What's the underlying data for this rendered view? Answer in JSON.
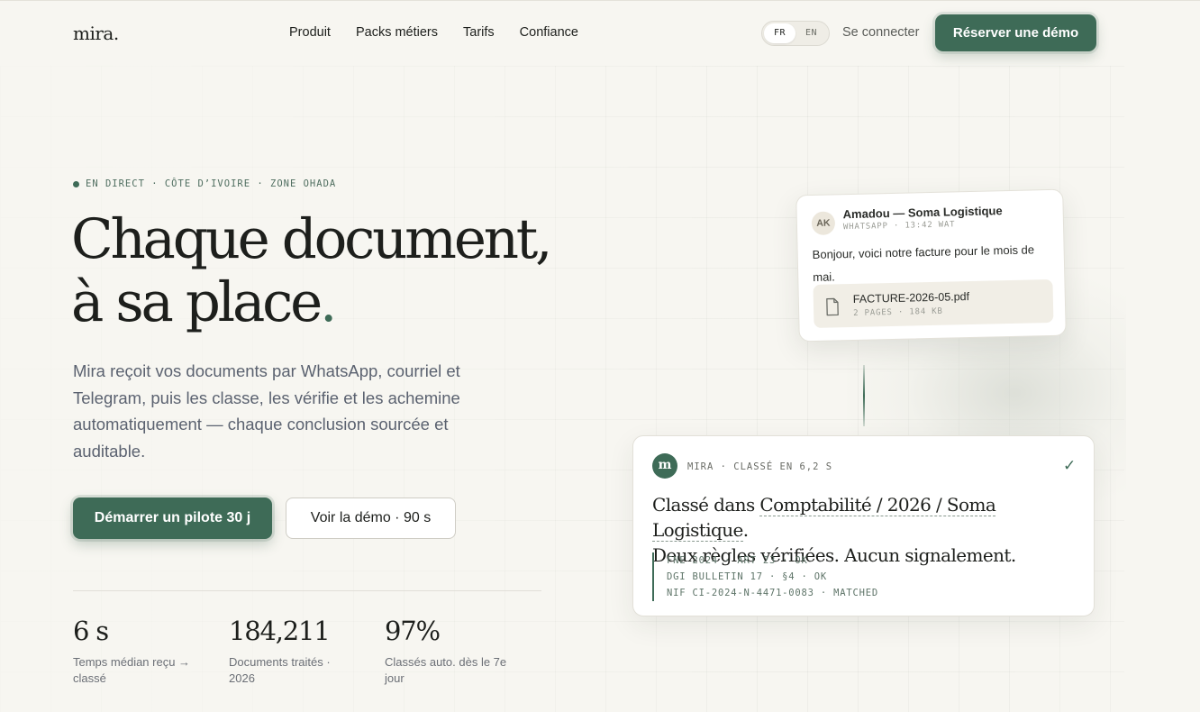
{
  "brand": {
    "logo": "mira."
  },
  "nav": {
    "items": [
      {
        "label": "Produit"
      },
      {
        "label": "Packs métiers"
      },
      {
        "label": "Tarifs"
      },
      {
        "label": "Confiance"
      }
    ],
    "lang": {
      "options": [
        "FR",
        "EN"
      ],
      "selected": "FR"
    },
    "login": "Se connecter",
    "cta": "Réserver une démo"
  },
  "hero": {
    "eyebrow": "EN DIRECT · CÔTE D’IVOIRE · ZONE OHADA",
    "headline_line1": "Chaque document,",
    "headline_line2": "à sa place",
    "headline_dot": ".",
    "lede": "Mira reçoit vos documents par WhatsApp, courriel et Telegram, puis les classe, les vérifie et les achemine automatiquement — chaque conclusion sourcée et auditable.",
    "primary_cta": "Démarrer un pilote 30 j",
    "secondary_cta": "Voir la démo · 90 s"
  },
  "stats": [
    {
      "value": "6 s",
      "label": "Temps médian reçu → classé"
    },
    {
      "value": "184,211",
      "label": "Documents traités · 2026"
    },
    {
      "value": "97%",
      "label": "Classés auto. dès le 7e jour"
    }
  ],
  "message_card": {
    "avatar": "AK",
    "sender": "Amadou — Soma Logistique",
    "meta": "WHATSAPP · 13:42 WAT",
    "text": "Bonjour, voici notre facture pour le mois de mai.",
    "file": {
      "name": "FACTURE-2026-05.pdf",
      "meta": "2 PAGES · 184 KB",
      "icon": "file-icon"
    }
  },
  "result_card": {
    "avatar": "m",
    "meta": "MIRA · CLASSÉ EN 6,2 S",
    "check": "✓",
    "title_prefix": "Classé dans ",
    "title_path": "Comptabilité / 2026 / Soma Logistique",
    "title_suffix": ".",
    "title_line2": "Deux règles vérifiées. Aucun signalement.",
    "rules": [
      "FNE 2024 · ART 23 · OK",
      "DGI BULLETIN 17 · §4 · OK",
      "NIF CI-2024-N-4471-0083 · MATCHED"
    ]
  },
  "colors": {
    "accent": "#3e6b57",
    "background": "#f7f6f1",
    "text": "#1d1f1c",
    "muted": "#5b6270"
  }
}
